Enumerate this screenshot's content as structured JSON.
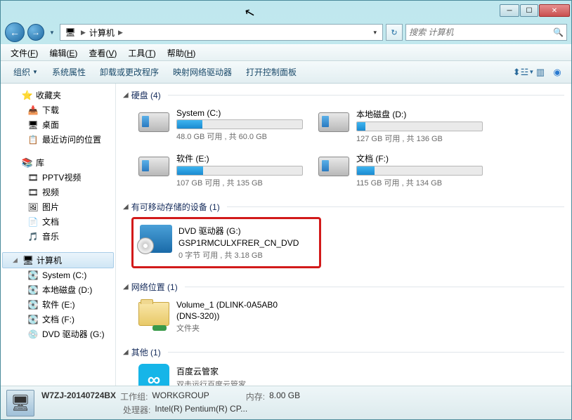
{
  "address": {
    "root": "计算机"
  },
  "search": {
    "placeholder": "搜索 计算机"
  },
  "menubar": [
    {
      "label": "文件",
      "key": "F"
    },
    {
      "label": "编辑",
      "key": "E"
    },
    {
      "label": "查看",
      "key": "V"
    },
    {
      "label": "工具",
      "key": "T"
    },
    {
      "label": "帮助",
      "key": "H"
    }
  ],
  "toolbar": {
    "organize": "组织",
    "items": [
      "系统属性",
      "卸载或更改程序",
      "映射网络驱动器",
      "打开控制面板"
    ]
  },
  "sidebar": {
    "favorites": {
      "label": "收藏夹",
      "items": [
        "下载",
        "桌面",
        "最近访问的位置"
      ]
    },
    "libraries": {
      "label": "库",
      "items": [
        "PPTV视频",
        "视频",
        "图片",
        "文档",
        "音乐"
      ]
    },
    "computer": {
      "label": "计算机",
      "items": [
        "System (C:)",
        "本地磁盘 (D:)",
        "软件 (E:)",
        "文档 (F:)",
        "DVD 驱动器 (G:)"
      ]
    }
  },
  "categories": {
    "hdd": {
      "label": "硬盘 (4)"
    },
    "removable": {
      "label": "有可移动存储的设备 (1)"
    },
    "network": {
      "label": "网络位置 (1)"
    },
    "other": {
      "label": "其他 (1)"
    }
  },
  "drives": [
    {
      "name": "System (C:)",
      "sub": "48.0 GB 可用 , 共 60.0 GB",
      "fill": 20
    },
    {
      "name": "本地磁盘 (D:)",
      "sub": "127 GB 可用 , 共 136 GB",
      "fill": 7
    },
    {
      "name": "软件 (E:)",
      "sub": "107 GB 可用 , 共 135 GB",
      "fill": 21
    },
    {
      "name": "文档 (F:)",
      "sub": "115 GB 可用 , 共 134 GB",
      "fill": 14
    }
  ],
  "dvd": {
    "line1": "DVD 驱动器 (G:)",
    "line2": "GSP1RMCULXFRER_CN_DVD",
    "sub": "0 字节 可用 , 共 3.18 GB"
  },
  "netloc": {
    "line1": "Volume_1 (DLINK-0A5AB0",
    "line2": "(DNS-320))",
    "sub": "文件夹"
  },
  "other_app": {
    "name": "百度云管家",
    "sub": "双击运行百度云管家"
  },
  "statusbar": {
    "name": "W7ZJ-20140724BX",
    "workgroup_label": "工作组:",
    "workgroup": "WORKGROUP",
    "mem_label": "内存:",
    "mem": "8.00 GB",
    "cpu_label": "处理器:",
    "cpu": "Intel(R) Pentium(R) CP..."
  }
}
